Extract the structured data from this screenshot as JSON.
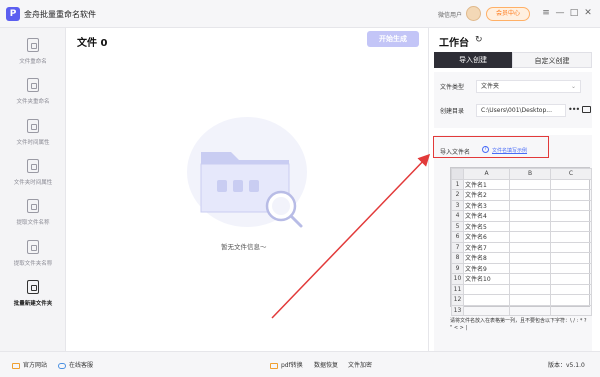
{
  "app": {
    "logo_text": "P",
    "title": "金舟批量重命名软件",
    "user_label": "微信用户",
    "vip_label": "会员中心",
    "min": "—",
    "max": "□",
    "close": "✕",
    "menu": "≡"
  },
  "sidebar": {
    "items": [
      {
        "label": "文件重命名",
        "icon": "file-rename-icon"
      },
      {
        "label": "文件夹重命名",
        "icon": "folder-rename-icon"
      },
      {
        "label": "文件时间属性",
        "icon": "file-time-icon"
      },
      {
        "label": "文件夹时间属性",
        "icon": "folder-time-icon"
      },
      {
        "label": "提取文件名称",
        "icon": "extract-file-name-icon"
      },
      {
        "label": "提取文件夹名称",
        "icon": "extract-folder-name-icon"
      },
      {
        "label": "批量新建文件夹",
        "icon": "batch-new-folder-icon"
      }
    ]
  },
  "main": {
    "title": "文件 0",
    "start_button": "开始生成",
    "empty_text": "暂无文件信息～"
  },
  "right": {
    "title": "工作台",
    "tab_import": "导入创建",
    "tab_custom": "自定义创建",
    "file_type_label": "文件类型",
    "file_type_value": "文件夹",
    "dir_label": "创建目录",
    "dir_value": "C:\\Users\\001\\Desktop...",
    "import_label": "导入文件名",
    "help_link": "文件名填写示例",
    "sheet": {
      "cols": [
        "A",
        "B",
        "C"
      ],
      "rows": [
        [
          "1",
          "文件名1"
        ],
        [
          "2",
          "文件名2"
        ],
        [
          "3",
          "文件名3"
        ],
        [
          "4",
          "文件名4"
        ],
        [
          "5",
          "文件名5"
        ],
        [
          "6",
          "文件名6"
        ],
        [
          "7",
          "文件名7"
        ],
        [
          "8",
          "文件名8"
        ],
        [
          "9",
          "文件名9"
        ],
        [
          "10",
          "文件名10"
        ],
        [
          "11",
          ""
        ],
        [
          "12",
          ""
        ],
        [
          "13",
          ""
        ]
      ]
    },
    "note": "请将文件名放入在表格第一列，且不要包含以下字符：\\ / : * ? \" < > |"
  },
  "bottom": {
    "website": "官方网站",
    "service": "在线客服",
    "pdf": "pdf转换",
    "recover": "数据恢复",
    "encrypt": "文件加密",
    "version": "版本：v5.1.0"
  },
  "colors": {
    "accent": "#5b5ef0",
    "highlight_red": "#e23a3a",
    "dark_tab": "#2e2e36",
    "start_disabled": "#c3c5f7"
  }
}
